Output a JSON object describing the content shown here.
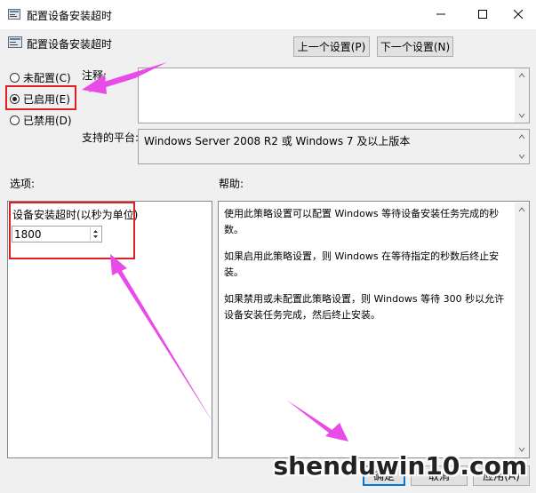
{
  "window": {
    "title": "配置设备安装超时",
    "minimize_icon": "minimize-icon",
    "maximize_icon": "maximize-icon",
    "close_icon": "close-icon"
  },
  "header": {
    "title": "配置设备安装超时",
    "prev_button": "上一个设置(P)",
    "next_button": "下一个设置(N)"
  },
  "state": {
    "options": [
      {
        "label": "未配置(C)",
        "selected": false
      },
      {
        "label": "已启用(E)",
        "selected": true
      },
      {
        "label": "已禁用(D)",
        "selected": false
      }
    ]
  },
  "comment": {
    "label": "注释:",
    "value": ""
  },
  "platform": {
    "label": "支持的平台:",
    "value": "Windows Server 2008 R2 或 Windows 7 及以上版本"
  },
  "options_section": {
    "label": "选项:",
    "timeout_label": "设备安装超时(以秒为单位)",
    "timeout_value": "1800"
  },
  "help_section": {
    "label": "帮助:",
    "paragraphs": [
      "使用此策略设置可以配置 Windows 等待设备安装任务完成的秒数。",
      "如果启用此策略设置，则 Windows 在等待指定的秒数后终止安装。",
      "如果禁用或未配置此策略设置，则 Windows 等待 300 秒以允许设备安装任务完成，然后终止安装。"
    ]
  },
  "footer": {
    "ok_button": "确定",
    "cancel_button": "取消",
    "apply_button": "应用(A)"
  },
  "watermark": "shenduwin10.com",
  "colors": {
    "annotation_arrow": "#e84be8",
    "highlight_box": "#e02020",
    "window_bg": "#f0f0f0"
  }
}
